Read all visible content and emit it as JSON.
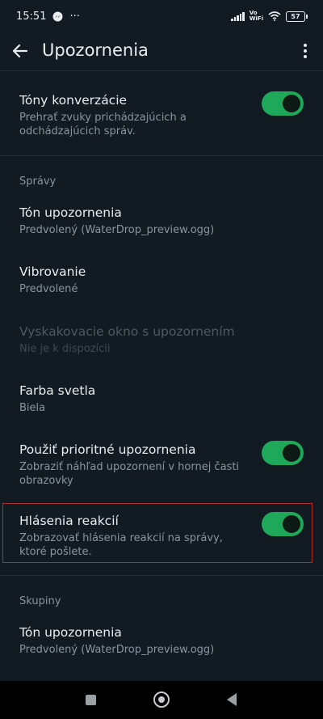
{
  "status_bar": {
    "time": "15:51",
    "more": "···",
    "vo": "Vo",
    "wifi_label": "WiFi",
    "battery": "57"
  },
  "app_bar": {
    "title": "Upozornenia"
  },
  "settings": {
    "conversation_tones": {
      "title": "Tóny konverzácie",
      "subtitle": "Prehrať zvuky prichádzajúcich a odchádzajúcich správ.",
      "enabled": true
    },
    "messages_section": {
      "header": "Správy",
      "notification_tone": {
        "title": "Tón upozornenia",
        "value": "Predvolený (WaterDrop_preview.ogg)"
      },
      "vibrate": {
        "title": "Vibrovanie",
        "value": "Predvolené"
      },
      "popup": {
        "title": "Vyskakovacie okno s upozornením",
        "value": "Nie je k dispozícii"
      },
      "light": {
        "title": "Farba svetla",
        "value": "Biela"
      },
      "priority": {
        "title": "Použiť prioritné upozornenia",
        "subtitle": "Zobraziť náhľad upozornení v hornej časti obrazovky",
        "enabled": true
      },
      "reactions": {
        "title": "Hlásenia reakcií",
        "subtitle": "Zobrazovať hlásenia reakcií na správy, ktoré pošlete.",
        "enabled": true
      }
    },
    "groups_section": {
      "header": "Skupiny",
      "notification_tone": {
        "title": "Tón upozornenia",
        "value": "Predvolený (WaterDrop_preview.ogg)"
      }
    }
  },
  "colors": {
    "background": "#121b22",
    "toggle_on": "#1da85a",
    "secondary_text": "#8696a0",
    "highlight": "#b22a2a"
  },
  "icons": {
    "back": "arrow-left-icon",
    "overflow": "more-vertical-icon",
    "nav_recents": "square-icon",
    "nav_home": "circle-icon",
    "nav_back": "triangle-icon"
  }
}
